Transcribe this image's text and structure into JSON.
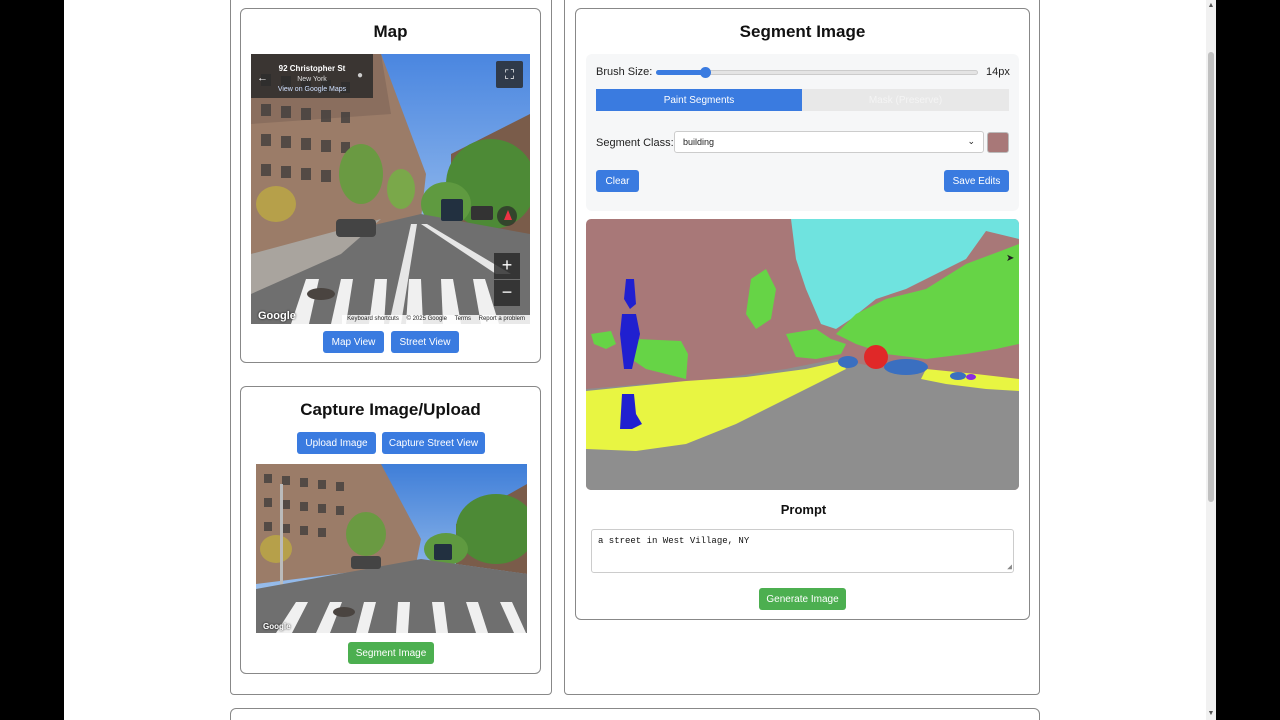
{
  "map_card": {
    "title": "Map",
    "streetview": {
      "address": "92 Christopher St",
      "city": "New York",
      "link": "View on Google Maps",
      "google_logo": "Google",
      "footer": [
        "Keyboard shortcuts",
        "© 2025 Google",
        "Terms",
        "Report a problem"
      ],
      "zoom_in": "+",
      "zoom_out": "−"
    },
    "map_view_button": "Map View",
    "street_view_button": "Street View"
  },
  "capture_card": {
    "title": "Capture Image/Upload",
    "upload_button": "Upload Image",
    "capture_button": "Capture Street View",
    "segment_button": "Segment Image",
    "google_logo": "Google"
  },
  "segment_card": {
    "title": "Segment Image",
    "brush_label": "Brush Size:",
    "brush_value": "14px",
    "brush_fraction": 0.15,
    "tabs": [
      {
        "label": "Paint Segments",
        "active": true
      },
      {
        "label": "Mask (Preserve)",
        "active": false
      }
    ],
    "class_label": "Segment Class:",
    "class_value": "building",
    "class_color": "#a87878",
    "clear_button": "Clear",
    "save_button": "Save Edits",
    "prompt_title": "Prompt",
    "prompt_value": "a street in West Village, NY",
    "generate_button": "Generate Image"
  },
  "colors": {
    "primary": "#3a7be0",
    "success": "#4caf50",
    "seg_building": "#a87878",
    "seg_sky": "#6fe3df",
    "seg_vegetation": "#66d446",
    "seg_road": "#8e8e8e",
    "seg_sidewalk": "#e8f542",
    "seg_person": "#2020d0",
    "seg_car": "#3a6fc0"
  }
}
